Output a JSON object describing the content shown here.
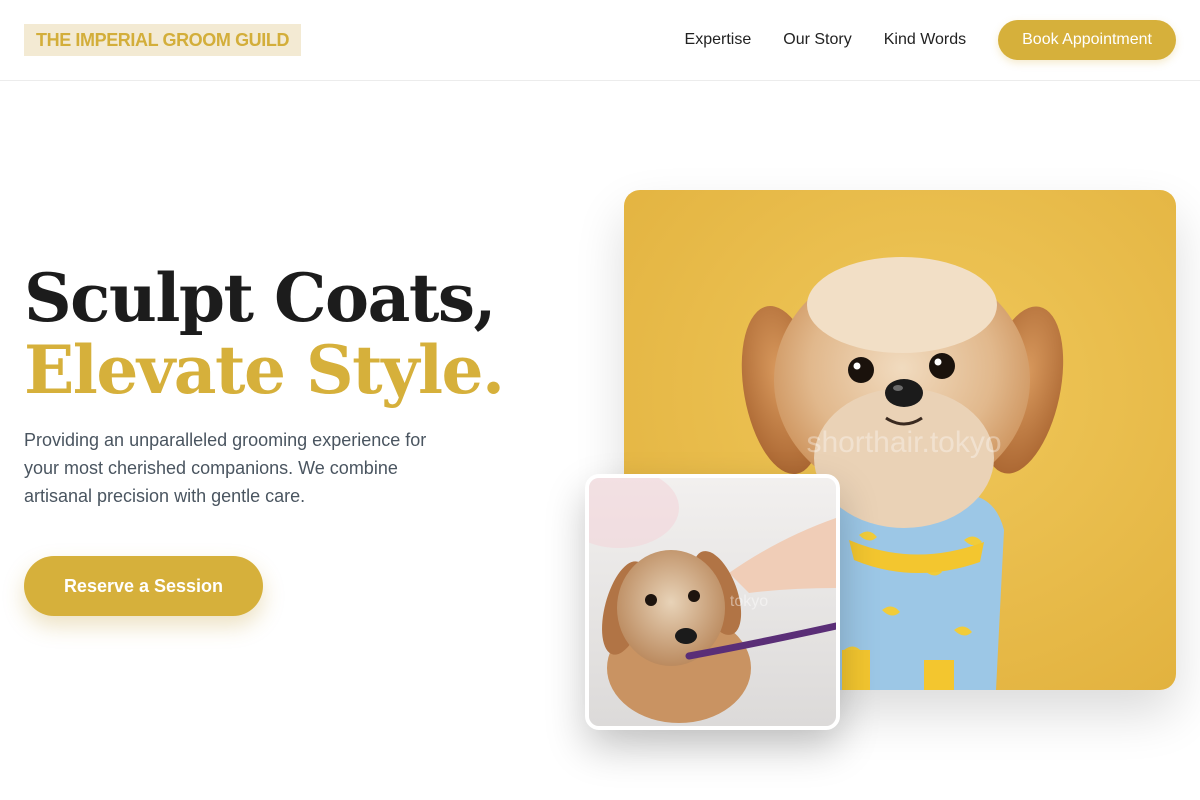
{
  "brand": {
    "name": "THE IMPERIAL GROOM GUILD"
  },
  "nav": {
    "links": [
      "Expertise",
      "Our Story",
      "Kind Words"
    ],
    "cta_label": "Book Appointment"
  },
  "hero": {
    "headline_line1": "Sculpt Coats,",
    "headline_line2": "Elevate Style.",
    "subtitle": "Providing an unparalleled grooming experience for your most cherished companions. We combine artisanal precision with gentle care.",
    "cta_label": "Reserve a Session"
  },
  "images": {
    "main_watermark": "shorthair.tokyo",
    "small_watermark": "tokyo"
  },
  "colors": {
    "accent": "#d6b03b",
    "logo_bg": "#f3ead3",
    "heading_dark": "#1c1c1c",
    "body_text": "#4a5560",
    "photo_bg": "#e9bd4a"
  }
}
